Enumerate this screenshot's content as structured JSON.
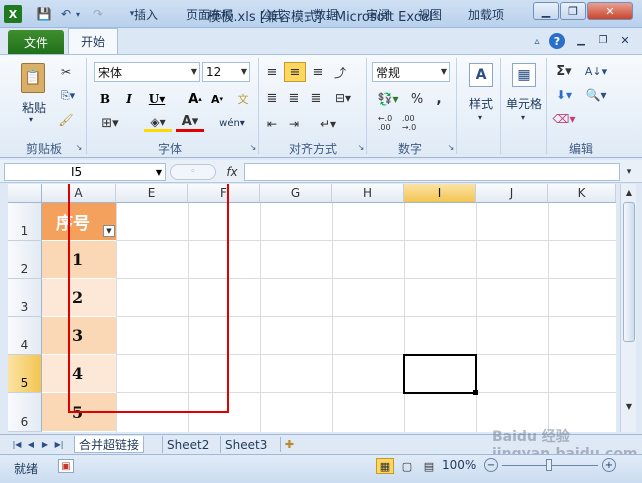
{
  "window": {
    "title": "模板.xls  [兼容模式] - Microsoft Excel"
  },
  "tabs": {
    "file": "文件",
    "home": "开始",
    "insert": "插入",
    "layout": "页面布局",
    "formulas": "公式",
    "data": "数据",
    "review": "审阅",
    "view": "视图",
    "addins": "加载项"
  },
  "ribbon": {
    "paste": "粘贴",
    "font_name": "宋体",
    "font_size": "12",
    "number_format": "常规",
    "styles": "样式",
    "cells": "单元格",
    "groups": {
      "clipboard": "剪贴板",
      "font": "字体",
      "alignment": "对齐方式",
      "number": "数字",
      "editing": "编辑"
    }
  },
  "formula_bar": {
    "name_box": "I5",
    "fx": "fx",
    "formula": ""
  },
  "grid": {
    "columns": [
      "A",
      "E",
      "F",
      "G",
      "H",
      "I",
      "J",
      "K"
    ],
    "rows": [
      "1",
      "2",
      "3",
      "4",
      "5",
      "6"
    ],
    "a_cells": [
      "序号",
      "1",
      "2",
      "3",
      "4",
      "5"
    ]
  },
  "sheets": [
    "合并超链接",
    "Sheet2",
    "Sheet3"
  ],
  "status": {
    "ready": "就绪",
    "zoom": "100%"
  },
  "watermark": "Baidu 经验 jingyan.baidu.com",
  "colors": {
    "header_fill": "#f4a15d",
    "cell_fill_odd": "#fad7b5",
    "cell_fill_even": "#fde8d7",
    "highlight_box": "#e00000",
    "file_tab": "#2e7d24"
  }
}
